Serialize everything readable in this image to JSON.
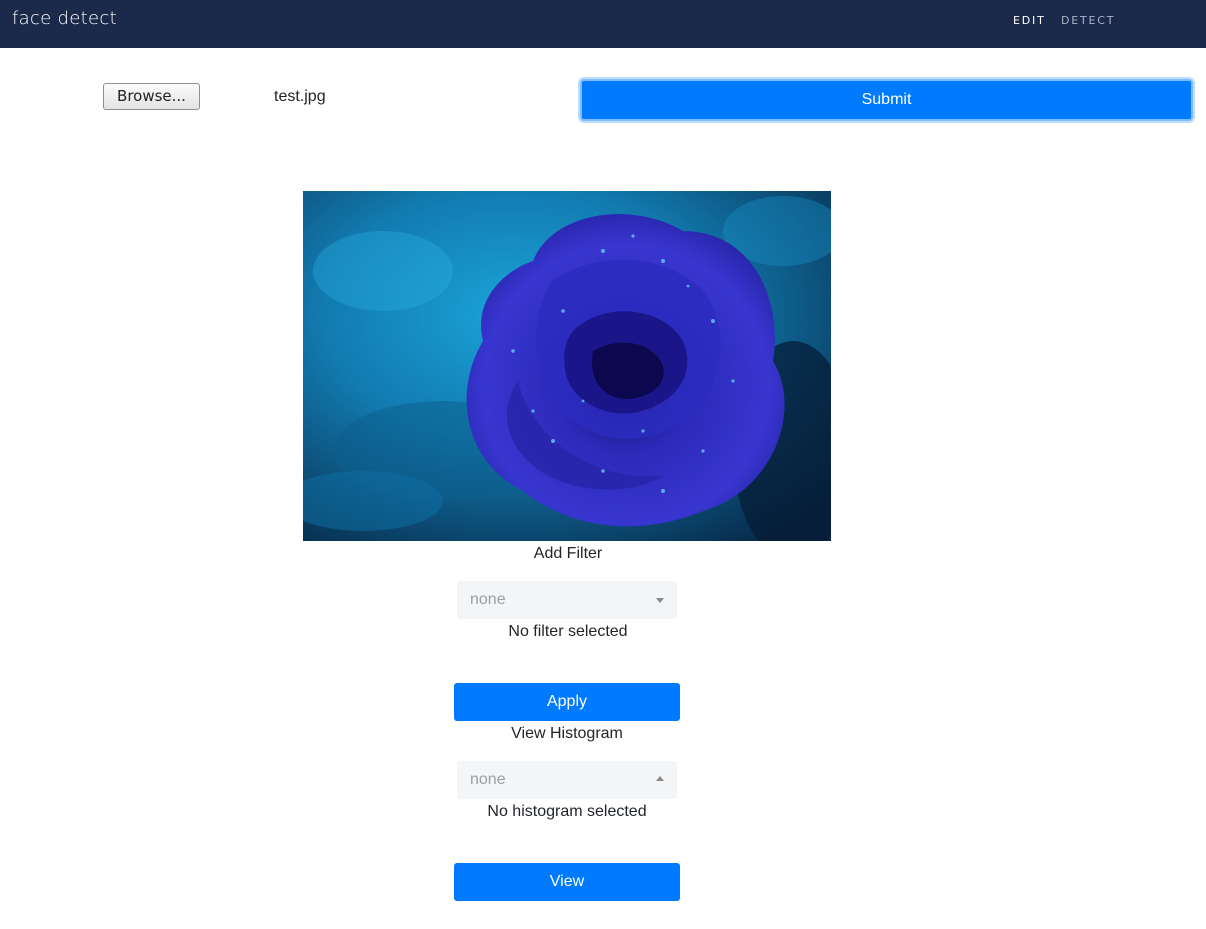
{
  "navbar": {
    "brand": "face detect",
    "links": [
      {
        "label": "EDIT",
        "active": true
      },
      {
        "label": "DETECT",
        "active": false
      }
    ],
    "background": "#1b2a4a"
  },
  "upload": {
    "browse_label": "Browse...",
    "file_name": "test.jpg",
    "submit_label": "Submit"
  },
  "preview": {
    "icon": "blue-rose-image"
  },
  "filter": {
    "heading": "Add Filter",
    "selected": "none",
    "status": "No filter selected",
    "apply_label": "Apply"
  },
  "histogram": {
    "heading": "View Histogram",
    "selected": "none",
    "status": "No histogram selected",
    "view_label": "View"
  },
  "colors": {
    "primary": "#007bff",
    "select_bg": "#f4f5f7"
  }
}
